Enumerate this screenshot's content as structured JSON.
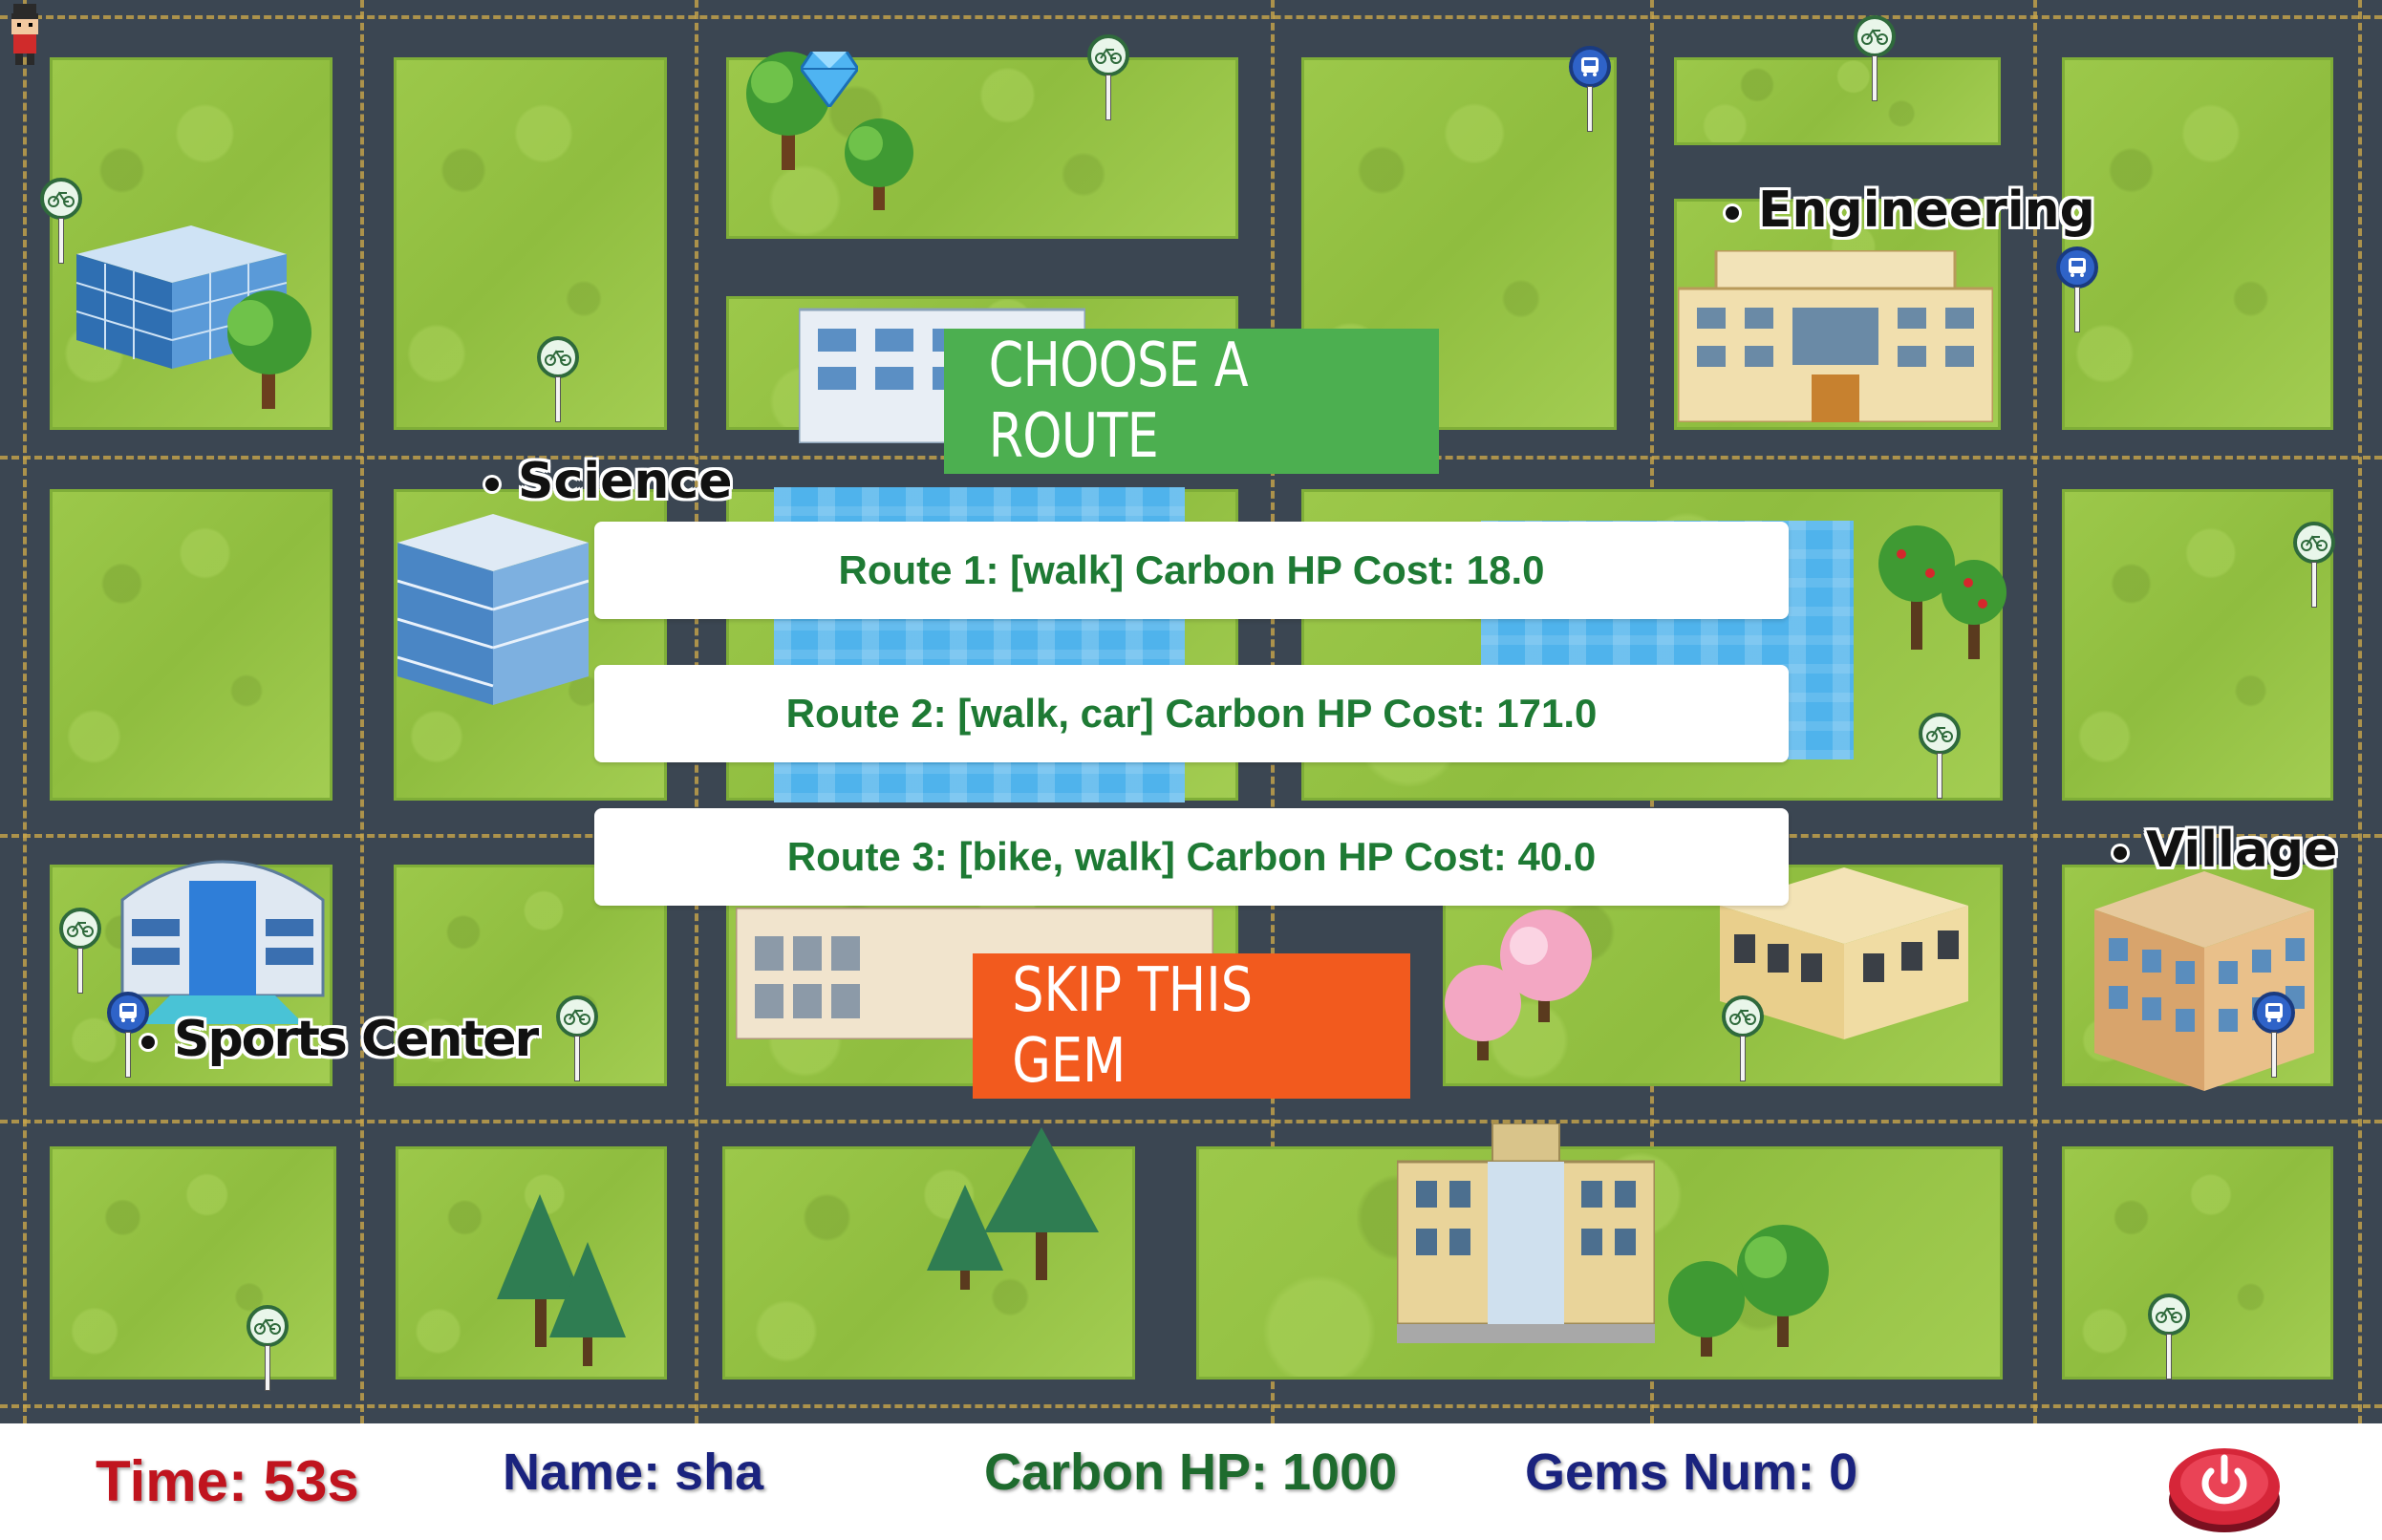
{
  "map": {
    "places": {
      "science": "Science",
      "engineering": "Engineering",
      "village": "Village",
      "sports_center": "Sports Center"
    },
    "gem_icon": "diamond-gem-icon",
    "icons": {
      "bike": "bicycle-icon",
      "bus": "bus-icon",
      "player": "player-avatar-icon"
    }
  },
  "dialog": {
    "title": "CHOOSE A ROUTE",
    "routes": [
      "Route 1: [walk] Carbon HP Cost: 18.0",
      "Route 2: [walk, car] Carbon HP Cost: 171.0",
      "Route 3: [bike, walk] Carbon HP Cost: 40.0"
    ],
    "skip_label": "SKIP THIS GEM"
  },
  "status": {
    "time": "Time: 53s",
    "name": "Name: sha",
    "carbon_hp": "Carbon HP: 1000",
    "gems": "Gems Num: 0"
  },
  "colors": {
    "title_button": "#4caf50",
    "skip_button": "#f25a1e",
    "route_text": "#1e7a34",
    "time_text": "#c0141e",
    "name_text": "#1a237e",
    "hp_text": "#1e6b2e",
    "gems_text": "#1a237e",
    "road": "#3b4652",
    "grass": "#9cc84a",
    "water": "#4fb3ec"
  }
}
